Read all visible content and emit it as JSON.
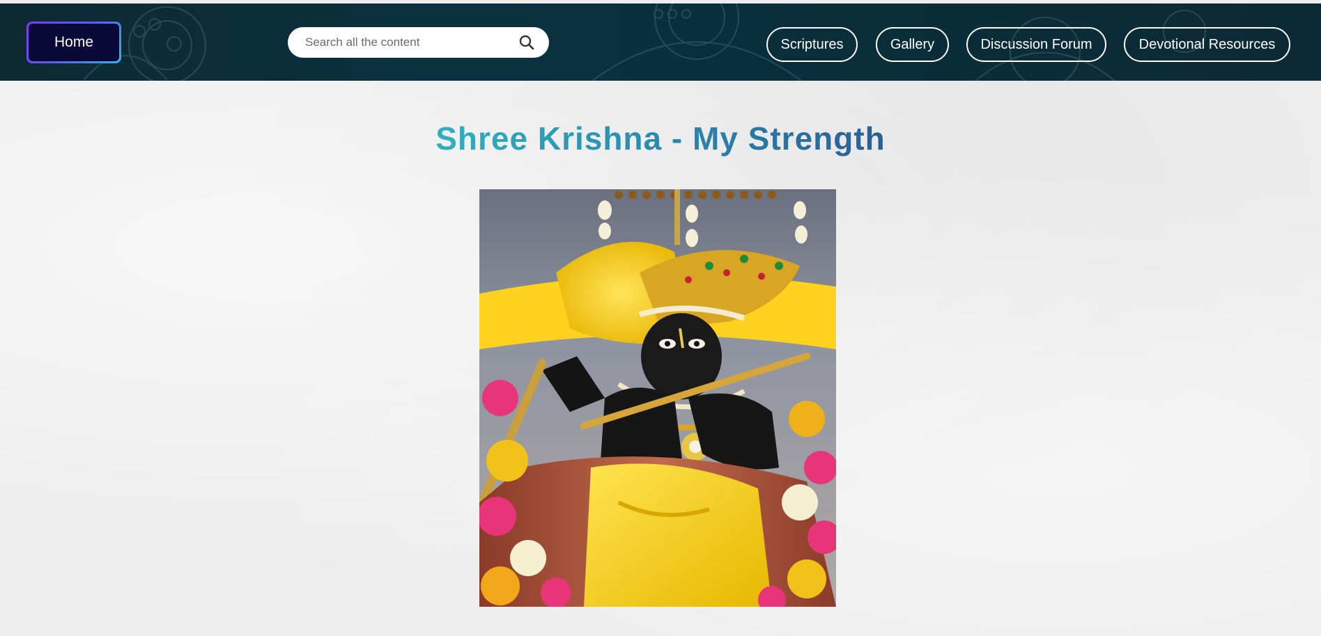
{
  "header": {
    "home_label": "Home",
    "search": {
      "placeholder": "Search all the content",
      "value": ""
    },
    "nav": [
      {
        "label": "Scriptures"
      },
      {
        "label": "Gallery"
      },
      {
        "label": "Discussion Forum"
      },
      {
        "label": "Devotional Resources"
      }
    ],
    "search_icon": "search-icon"
  },
  "main": {
    "title": "Shree Krishna - My Strength",
    "image": {
      "subject": "krishna-deity-photo"
    }
  },
  "colors": {
    "header_bg": "#0b2f3c",
    "home_bg": "#0a0a38",
    "title_gradient_start": "#2fb0c0",
    "title_gradient_end": "#2a5f96",
    "page_bg": "#ececec"
  }
}
